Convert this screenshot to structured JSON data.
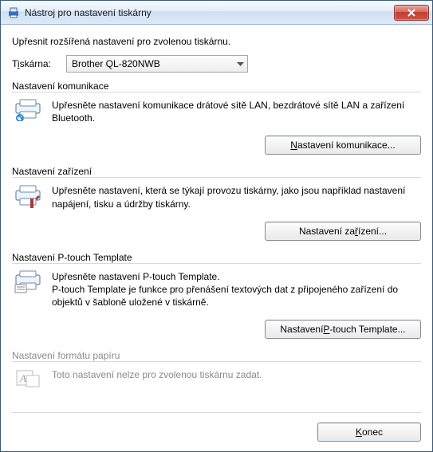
{
  "window": {
    "title": "Nástroj pro nastavení tiskárny"
  },
  "subtitle": "Upřesnit rozšířená nastavení pro zvolenou tiskárnu.",
  "printer": {
    "label_pre": "T",
    "label_u": "i",
    "label_post": "skárna:",
    "selected": "Brother QL-820NWB"
  },
  "groups": {
    "comm": {
      "legend": "Nastavení komunikace",
      "desc": "Upřesněte nastavení komunikace drátové sítě LAN, bezdrátové sítě LAN a zařízení Bluetooth.",
      "button_pre": "",
      "button_u": "N",
      "button_post": "astavení komunikace..."
    },
    "device": {
      "legend": "Nastavení zařízení",
      "desc": "Upřesněte nastavení, která se týkají provozu tiskárny, jako jsou například nastavení napájení, tisku a údržby tiskárny.",
      "button_pre": "Nastavení za",
      "button_u": "ř",
      "button_post": "ízení..."
    },
    "template": {
      "legend": "Nastavení P-touch Template",
      "desc": "Upřesněte nastavení P-touch Template.\nP-touch Template je funkce pro přenášení textových dat z připojeného zařízení do objektů v šabloně uložené v tiskárně.",
      "button_pre": "Nastavení ",
      "button_u": "P",
      "button_post": "-touch Template..."
    },
    "paper": {
      "legend": "Nastavení formátu papíru",
      "desc": "Toto nastavení nelze pro zvolenou tiskárnu zadat."
    }
  },
  "footer": {
    "close_pre": "",
    "close_u": "K",
    "close_post": "onec"
  }
}
